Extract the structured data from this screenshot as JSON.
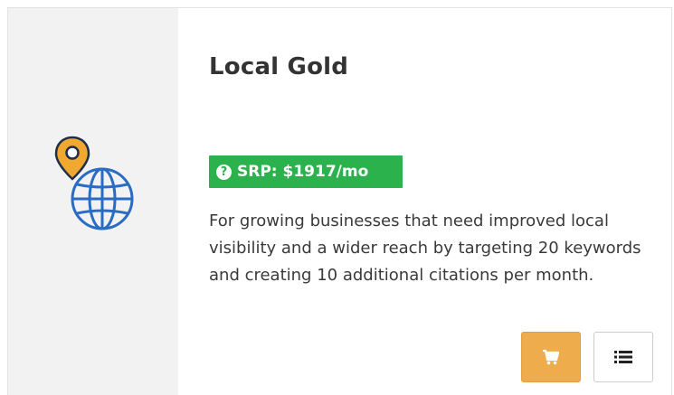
{
  "product": {
    "name": "Local Gold",
    "price_label": "SRP: $1917/mo",
    "help_glyph": "?",
    "description": "For growing businesses that need improved local visibility and a wider reach by targeting 20 keywords and creating 10 additional citations per month."
  },
  "icons": {
    "product_icon": "globe-with-map-pin-icon",
    "cart": "shopping-cart-icon",
    "details": "list-icon"
  },
  "colors": {
    "panel_bg": "#f2f2f2",
    "globe_blue": "#2a6cc4",
    "pin_orange": "#f0a830",
    "badge_green": "#2bb24c",
    "cart_button_bg": "#efac4c"
  }
}
